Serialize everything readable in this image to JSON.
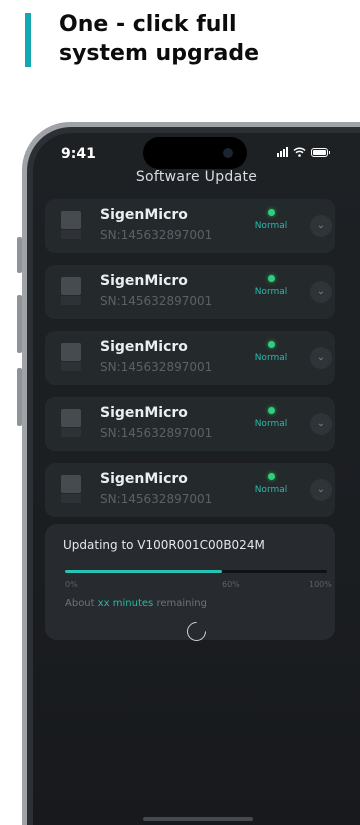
{
  "headline": "One - click full system upgrade",
  "status_bar": {
    "time": "9:41"
  },
  "screen_title": "Software Update",
  "devices": [
    {
      "name": "SigenMicro",
      "sn": "SN:145632897001",
      "status": "Normal"
    },
    {
      "name": "SigenMicro",
      "sn": "SN:145632897001",
      "status": "Normal"
    },
    {
      "name": "SigenMicro",
      "sn": "SN:145632897001",
      "status": "Normal"
    },
    {
      "name": "SigenMicro",
      "sn": "SN:145632897001",
      "status": "Normal"
    },
    {
      "name": "SigenMicro",
      "sn": "SN:145632897001",
      "status": "Normal"
    }
  ],
  "update": {
    "text": "Updating to V100R001C00B024M",
    "progress": 0.6,
    "labels": [
      "0%",
      "60%",
      "100%"
    ],
    "remaining_prefix": "About",
    "remaining_highlight": "xx minutes",
    "remaining_suffix": "remaining"
  },
  "colors": {
    "accent": "#12a7b1",
    "progress": "#29c2b3",
    "status_ok": "#2fd07a"
  },
  "icons": [
    "signal-icon",
    "wifi-icon",
    "battery-icon",
    "device-icon",
    "chevron-down-icon",
    "loading-spinner-icon"
  ]
}
